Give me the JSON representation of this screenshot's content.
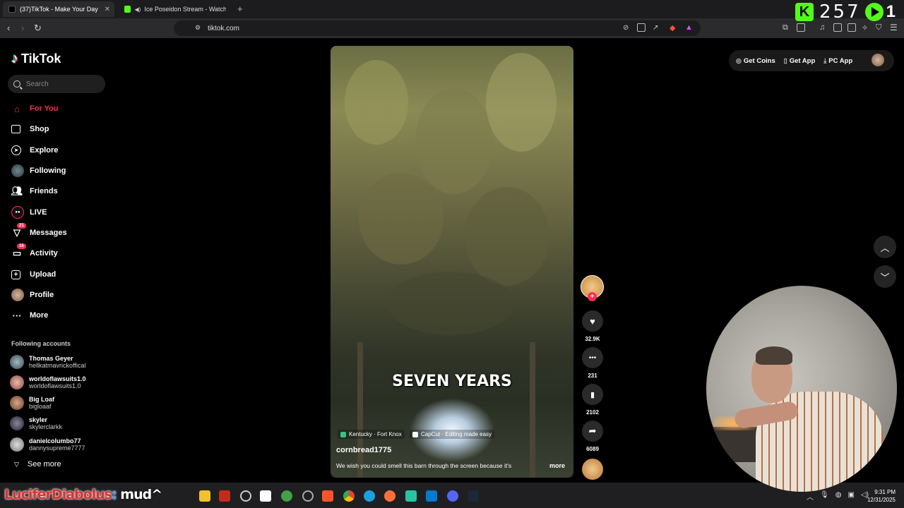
{
  "browser": {
    "tabs": [
      {
        "title": "(37)TikTok - Make Your Day",
        "active": true
      },
      {
        "title": "Ice Poseidon Stream - Watch Live",
        "active": false
      }
    ],
    "new_tab": "+",
    "url": "tiktok.com"
  },
  "kick_overlay": {
    "logo": "K",
    "count": "257",
    "suffix": "1"
  },
  "sidebar": {
    "logo": "TikTok",
    "search_placeholder": "Search",
    "nav": [
      {
        "label": "For You",
        "icon": "home-icon",
        "active": true
      },
      {
        "label": "Shop",
        "icon": "shop-bag-icon"
      },
      {
        "label": "Explore",
        "icon": "compass-icon"
      },
      {
        "label": "Following",
        "icon": "avatar-icon"
      },
      {
        "label": "Friends",
        "icon": "friends-icon"
      },
      {
        "label": "LIVE",
        "icon": "live-icon"
      },
      {
        "label": "Messages",
        "icon": "send-icon",
        "badge": "21"
      },
      {
        "label": "Activity",
        "icon": "activity-icon",
        "badge": "16"
      },
      {
        "label": "Upload",
        "icon": "upload-icon"
      },
      {
        "label": "Profile",
        "icon": "profile-avatar-icon"
      },
      {
        "label": "More",
        "icon": "ellipsis-icon"
      }
    ],
    "following_title": "Following accounts",
    "accounts": [
      {
        "name": "Thomas Geyer",
        "handle": "hellkatmavrickoffical"
      },
      {
        "name": "worldoflawsuits1.0",
        "handle": "worldoflawsuits1.0"
      },
      {
        "name": "Big Loaf",
        "handle": "bigloaaf"
      },
      {
        "name": "skyler",
        "handle": "skylerclarkk"
      },
      {
        "name": "danielcolumbo77",
        "handle": "dannysupreme7777"
      }
    ],
    "see_more": "See more"
  },
  "video": {
    "overlay_text": "SEVEN YEARS",
    "location_tag": "Kentucky · Fort Knox",
    "capcut_tag": "CapCut · Editing made easy",
    "author": "cornbread1775",
    "description": "We wish you could smell this barn through the screen because it's",
    "more": "more"
  },
  "actions": {
    "likes": "32.9K",
    "comments": "231",
    "saves": "2102",
    "shares": "6089"
  },
  "topright": {
    "get_coins": "Get Coins",
    "get_app": "Get App",
    "pc_app": "PC App"
  },
  "taskbar": {
    "overlay_text_red": "LuciferDiabolus",
    "overlay_text_sep": ": ",
    "overlay_text_white": "mud^",
    "clock_time": "9:31 PM",
    "clock_date": "12/31/2025"
  },
  "colors": {
    "accent": "#fe2c55",
    "kick_green": "#53fc18"
  }
}
